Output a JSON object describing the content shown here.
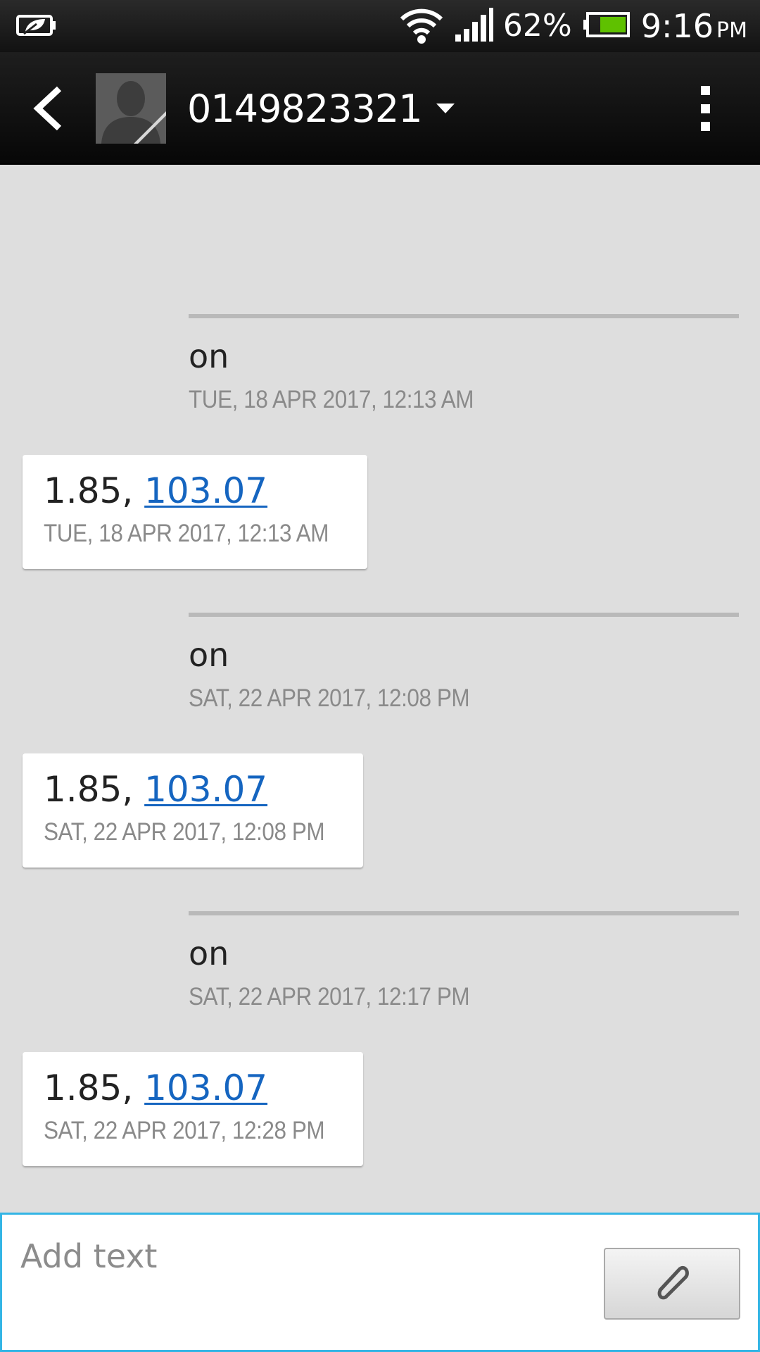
{
  "status_bar": {
    "battery_percent": "62%",
    "time": "9:16",
    "ampm": "PM",
    "icons": [
      "power-saver-icon",
      "wifi-icon",
      "signal-icon",
      "battery-icon"
    ]
  },
  "header": {
    "contact_number": "0149823321",
    "icons": [
      "back-icon",
      "contact-avatar",
      "dropdown-caret-icon",
      "overflow-menu-icon"
    ]
  },
  "conversation": [
    {
      "type": "sent",
      "text": "on",
      "timestamp": "TUE, 18 APR 2017, 12:13 AM"
    },
    {
      "type": "received",
      "text_prefix": "1.85, ",
      "link_text": "103.07",
      "timestamp": "TUE, 18 APR 2017, 12:13 AM"
    },
    {
      "type": "sent",
      "text": "on",
      "timestamp": "SAT, 22 APR 2017, 12:08 PM"
    },
    {
      "type": "received",
      "text_prefix": "1.85, ",
      "link_text": "103.07",
      "timestamp": "SAT, 22 APR 2017, 12:08 PM"
    },
    {
      "type": "sent",
      "text": "on",
      "timestamp": "SAT, 22 APR 2017, 12:17 PM"
    },
    {
      "type": "received",
      "text_prefix": "1.85, ",
      "link_text": "103.07",
      "timestamp": "SAT, 22 APR 2017, 12:28 PM"
    }
  ],
  "composer": {
    "placeholder": "Add text",
    "value": "",
    "attach_icon": "paperclip-icon"
  },
  "colors": {
    "background": "#dedede",
    "link": "#1565c0",
    "composer_border": "#33b5e5",
    "battery_fill": "#5fc100"
  }
}
